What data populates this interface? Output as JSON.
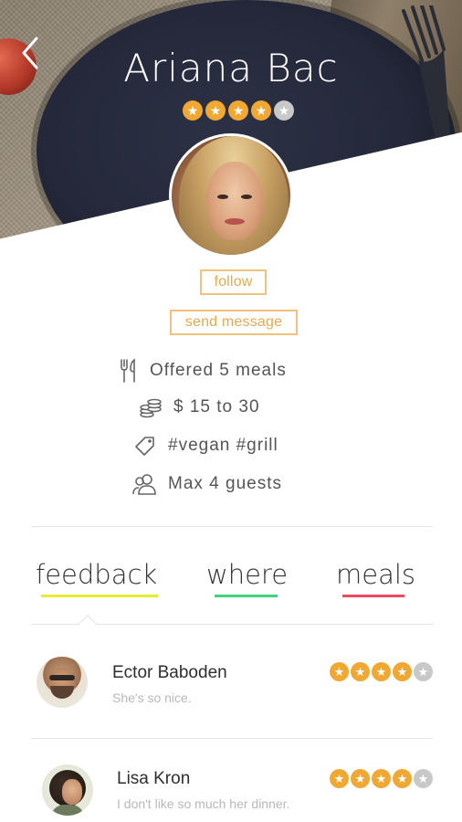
{
  "profile": {
    "name": "Ariana Bac",
    "rating": 4,
    "rating_max": 5
  },
  "actions": {
    "follow_label": "follow",
    "message_label": "send message"
  },
  "info": {
    "meals": "Offered 5 meals",
    "price": "$ 15 to 30",
    "tags": "#vegan #grill",
    "guests": "Max 4 guests"
  },
  "tabs": [
    {
      "label": "feedback",
      "underline_color": "#e6ec2c",
      "active": true
    },
    {
      "label": "where",
      "underline_color": "#3cd67a",
      "active": false
    },
    {
      "label": "meals",
      "underline_color": "#f04a5c",
      "active": false
    }
  ],
  "feedback": [
    {
      "name": "Ector Baboden",
      "comment": "She's so nice.",
      "rating": 4
    },
    {
      "name": "Lisa Kron",
      "comment": "I don't like so much her dinner.",
      "rating": 4
    }
  ],
  "colors": {
    "accent_orange": "#f0a832",
    "star_off": "#c8c8c8",
    "button_border": "#f0c27b"
  },
  "icons": {
    "back": "chevron-left-icon",
    "meals": "fork-knife-icon",
    "price": "coins-icon",
    "tags": "tag-icon",
    "guests": "people-icon",
    "star": "star-icon"
  }
}
